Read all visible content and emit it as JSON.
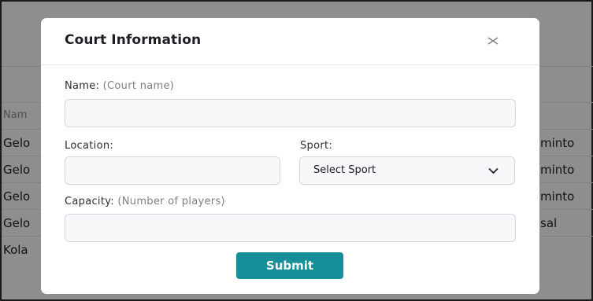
{
  "background": {
    "table_header": "Nam",
    "rows": [
      {
        "name": "Gelo",
        "sport": "minto"
      },
      {
        "name": "Gelo",
        "sport": "minto"
      },
      {
        "name": "Gelo",
        "sport": "minto"
      },
      {
        "name": "Gelo",
        "sport": "sal"
      },
      {
        "name": "Kola",
        "sport": ""
      }
    ]
  },
  "modal": {
    "title": "Court Information",
    "close_icon": "close-icon",
    "name_label": "Name:",
    "name_hint": "(Court name)",
    "name_value": "",
    "location_label": "Location:",
    "location_value": "",
    "sport_label": "Sport:",
    "sport_selected": "Select Sport",
    "capacity_label": "Capacity:",
    "capacity_hint": "(Number of players)",
    "capacity_value": "",
    "submit_label": "Submit",
    "accent_color": "#178f98"
  }
}
